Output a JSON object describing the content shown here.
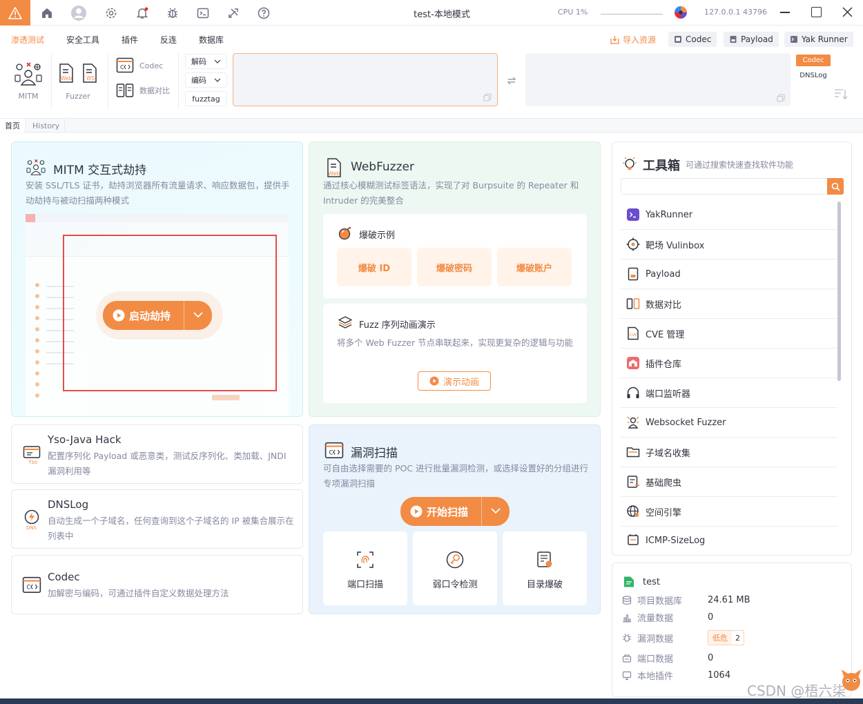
{
  "window": {
    "title": "test-本地模式",
    "cpu": "CPU 1%",
    "ip": "127.0.0.1 43796"
  },
  "colors": {
    "accent": "#f28b44",
    "text": "#31343f",
    "muted": "#85899e",
    "red": "#e82b2b",
    "purple": "#6a4ccf"
  },
  "menu": [
    "渗透测试",
    "安全工具",
    "插件",
    "反连",
    "数据库"
  ],
  "top_buttons": {
    "import": "导入资源",
    "codec": "Codec",
    "payload": "Payload",
    "yakrunner": "Yak Runner"
  },
  "toolbar": {
    "mitm": "MITM",
    "fuzzer": "Fuzzer",
    "codec": "Codec",
    "compare": "数据对比",
    "decode": "解码",
    "encode": "编码",
    "fuzztag": "fuzztag",
    "codec_tab": "Codec",
    "dnslog_tab": "DNSLog"
  },
  "tabs": [
    "首页",
    "History"
  ],
  "mitm_card": {
    "title": "MITM 交互式劫持",
    "desc": "安装 SSL/TLS 证书，劫持浏览器所有流量请求、响应数据包，提供手动劫持与被动扫描两种模式",
    "button": "启动劫持"
  },
  "webfuzzer_card": {
    "title": "WebFuzzer",
    "desc": "通过核心模糊测试标签语法，实现了对 Burpsuite 的 Repeater 和 Intruder 的完美整合",
    "example_title": "爆破示例",
    "pills": [
      "爆破 ID",
      "爆破密码",
      "爆破账户"
    ],
    "fuzz_title": "Fuzz 序列动画演示",
    "fuzz_desc": "将多个 Web Fuzzer 节点串联起来，实现更复杂的逻辑与功能",
    "fuzz_button": "演示动画"
  },
  "small_cards": [
    {
      "title": "Yso-Java Hack",
      "desc": "配置序列化 Payload 或恶意类，测试反序列化、类加载、JNDI 漏洞利用等"
    },
    {
      "title": "DNSLog",
      "desc": "自动生成一个子域名，任何查询到这个子域名的 IP 被集合展示在列表中"
    },
    {
      "title": "Codec",
      "desc": "加解密与编码，可通过插件自定义数据处理方法"
    }
  ],
  "scan_card": {
    "title": "漏洞扫描",
    "desc": "可自由选择需要的 POC 进行批量漏洞检测，或选择设置好的分组进行专项漏洞扫描",
    "button": "开始扫描",
    "tiles": [
      "端口扫描",
      "弱口令检测",
      "目录爆破"
    ]
  },
  "toolbox": {
    "title": "工具箱",
    "hint": "可通过搜索快速查找软件功能",
    "items": [
      "YakRunner",
      "靶场 Vulinbox",
      "Payload",
      "数据对比",
      "CVE 管理",
      "插件仓库",
      "端口监听器",
      "Websocket Fuzzer",
      "子域名收集",
      "基础爬虫",
      "空间引擎",
      "ICMP-SizeLog"
    ]
  },
  "project": {
    "name": "test",
    "rows": [
      {
        "label": "项目数据库",
        "value": "24.61 MB"
      },
      {
        "label": "流量数据",
        "value": "0"
      },
      {
        "label": "漏洞数据",
        "badge": "低危",
        "count": "2"
      },
      {
        "label": "端口数据",
        "value": "0"
      },
      {
        "label": "本地插件",
        "value": "1064"
      }
    ]
  },
  "watermark": "CSDN @梧六柒"
}
